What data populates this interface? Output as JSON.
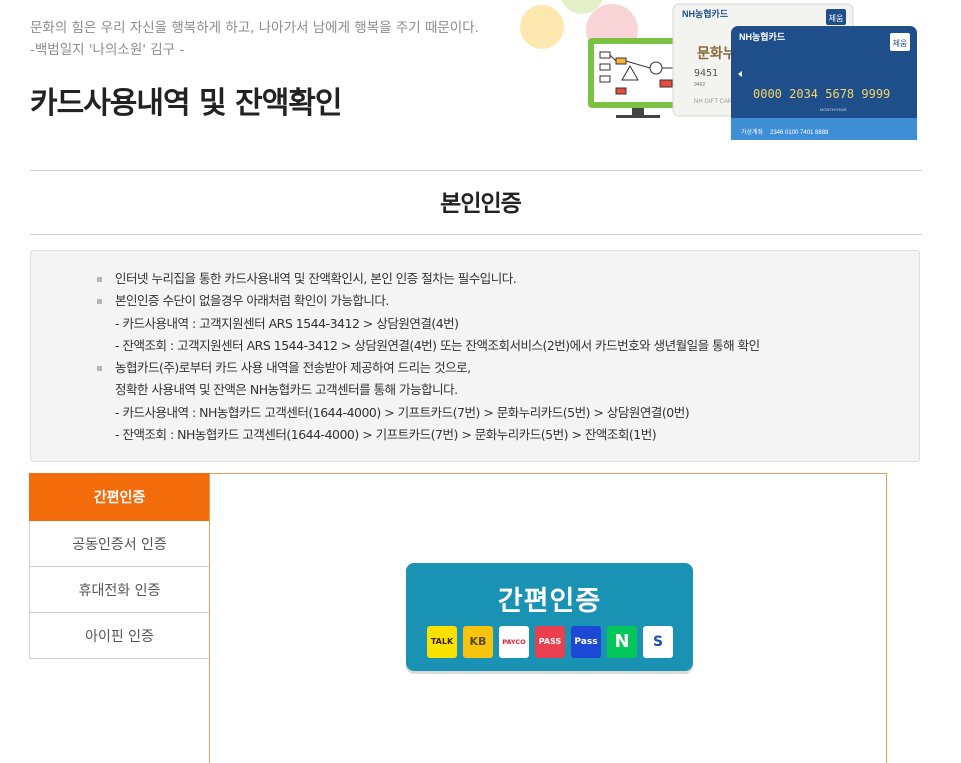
{
  "header": {
    "quote_line1": "문화의 힘은 우리 자신을 행복하게 하고, 나아가서 남에게 행복을 주기 때문이다.",
    "quote_line2": "-백범일지 '나의소원' 김구 -",
    "page_title": "카드사용내역 및 잔액확인"
  },
  "hero": {
    "card_back_brand": "NH농협카드",
    "card_back_name": "문화누리",
    "card_back_number": "9451",
    "card_back_sub": "9462",
    "card_back_gift": "NH GIFT CARD",
    "card_back_badge": "체움",
    "card_front_brand": "NH농협카드",
    "card_front_badge": "체움",
    "card_front_number": "0000 2034 5678 9999",
    "card_front_expiry": "MONTH/YEAR",
    "card_front_account_label": "가상계좌",
    "card_front_account": "2346 0100 7401 8888",
    "colors": {
      "card_front": "#1f4f8a",
      "monitor": "#7cc242"
    }
  },
  "section": {
    "title": "본인인증"
  },
  "notice": {
    "items": [
      {
        "lines": [
          "인터넷 누리집을 통한 카드사용내역 및 잔액확인시, 본인 인증 절차는 필수입니다."
        ]
      },
      {
        "lines": [
          "본인인증 수단이 없을경우 아래처럼 확인이 가능합니다.",
          "- 카드사용내역 : 고객지원센터 ARS 1544-3412 > 상담원연결(4번)",
          "- 잔액조회 : 고객지원센터 ARS 1544-3412 > 상담원연결(4번) 또는 잔액조회서비스(2번)에서 카드번호와 생년월일을 통해 확인"
        ]
      },
      {
        "lines": [
          "농협카드(주)로부터 카드 사용 내역을 전송받아 제공하여 드리는 것으로,",
          "정확한 사용내역 및 잔액은 NH농협카드 고객센터를 통해 가능합니다.",
          "- 카드사용내역 : NH농협카드 고객센터(1644-4000) > 기프트카드(7번) > 문화누리카드(5번) > 상담원연결(0번)",
          "- 잔액조회 : NH농협카드 고객센터(1644-4000) > 기프트카드(7번) > 문화누리카드(5번) > 잔액조회(1번)"
        ]
      }
    ]
  },
  "tabs": [
    {
      "label": "간편인증",
      "active": true
    },
    {
      "label": "공동인증서 인증",
      "active": false
    },
    {
      "label": "휴대전화 인증",
      "active": false
    },
    {
      "label": "아이핀 인증",
      "active": false
    }
  ],
  "easy_auth": {
    "title": "간편인증",
    "providers": [
      {
        "icon": "kakao-talk-icon",
        "label": "TALK",
        "bg": "#fae100",
        "fg": "#3b1e1e"
      },
      {
        "icon": "kb-bank-icon",
        "label": "KB",
        "bg": "#f6c40c",
        "fg": "#5a4a2a"
      },
      {
        "icon": "payco-icon",
        "label": "PAYCO",
        "bg": "#ffffff",
        "fg": "#e5212f"
      },
      {
        "icon": "pass-icon",
        "label": "PASS",
        "bg": "#ea3f4e",
        "fg": "#ffffff"
      },
      {
        "icon": "samsung-pass-icon",
        "label": "Pass",
        "bg": "#1d47d5",
        "fg": "#ffffff"
      },
      {
        "icon": "naver-icon",
        "label": "N",
        "bg": "#03c75a",
        "fg": "#ffffff"
      },
      {
        "icon": "shinhan-icon",
        "label": "S",
        "bg": "#ffffff",
        "fg": "#1d4fb0"
      }
    ],
    "colors": {
      "button": "#1a92b4",
      "active_tab": "#f26c0c"
    }
  }
}
